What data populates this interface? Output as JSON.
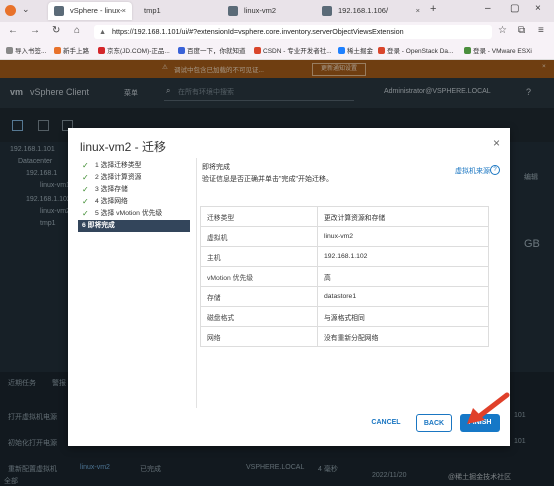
{
  "browser": {
    "tabs": [
      {
        "label": "vSphere - linux-vm2",
        "active": true
      },
      {
        "label": "tmp1",
        "active": false
      },
      {
        "label": "linux-vm2",
        "active": false
      },
      {
        "label": "192.168.1.106/",
        "active": false
      }
    ],
    "url": "https://192.168.1.101/ui/#?extensionId=vsphere.core.inventory.serverObjectViewsExtension",
    "bookmarks": [
      "导入书签...",
      "新手上路",
      "京东(JD.COM)-正品...",
      "百度一下，你就知道",
      "CSDN - 专业开发者社...",
      "稀土掘金",
      "登录 - OpenStack Da...",
      "登录 - VMware ESXi"
    ]
  },
  "banner": {
    "text": "调试中包含已加载的不可见证...",
    "button": "更新通知设置"
  },
  "app": {
    "title": "vSphere Client",
    "menu": "菜单",
    "search_placeholder": "在所有环境中搜索",
    "user": "Administrator@VSPHERE.LOCAL"
  },
  "inventory": {
    "items": [
      "192.168.1.101",
      "Datacenter",
      "192.168.1",
      "linux-vm1",
      "192.168.1.102",
      "linux-vm2",
      "tmp1"
    ]
  },
  "right_panel": {
    "texts": [
      "编辑",
      "GB"
    ]
  },
  "bottom": {
    "tabs": [
      "近期任务",
      "警报"
    ],
    "rows": [
      {
        "task": "打开虚拟机电源",
        "value": "101"
      },
      {
        "task": "初始化打开电源",
        "value": "101"
      },
      {
        "task": "重新配置虚拟机",
        "target": "linux-vm2",
        "status": "已完成",
        "server": "VSPHERE.LOCAL",
        "time": "2022/11/20",
        "count": "4 毫秒"
      }
    ],
    "filter": "全部",
    "watermark": "@稀土掘金技术社区"
  },
  "dialog": {
    "title": "linux-vm2 - 迁移",
    "close": "×",
    "steps": [
      {
        "label": "1 选择迁移类型",
        "done": true
      },
      {
        "label": "2 选择计算资源",
        "done": true
      },
      {
        "label": "3 选择存储",
        "done": true
      },
      {
        "label": "4 选择网络",
        "done": true
      },
      {
        "label": "5 选择 vMotion 优先级",
        "done": true
      },
      {
        "label": "6 即将完成",
        "done": false
      }
    ],
    "header": "即将完成",
    "subheader": "验证信息是否正确并单击\"完成\"开始迁移。",
    "help_link": "虚拟机来源",
    "help_icon": "?",
    "summary": [
      {
        "key": "迁移类型",
        "value": "更改计算资源和存储"
      },
      {
        "key": "虚拟机",
        "value": "linux-vm2"
      },
      {
        "key": "主机",
        "value": "192.168.1.102"
      },
      {
        "key": "vMotion 优先级",
        "value": "高"
      },
      {
        "key": "存储",
        "value": "datastore1"
      },
      {
        "key": "磁盘格式",
        "value": "与源格式相同"
      },
      {
        "key": "网络",
        "value": "没有重新分配网络"
      }
    ],
    "buttons": {
      "cancel": "CANCEL",
      "back": "BACK",
      "finish": "FINISH"
    }
  },
  "colors": {
    "accent": "#1678c7",
    "arrow": "#e0402a",
    "active_step": "#33455b",
    "check": "#3c8b2e"
  }
}
